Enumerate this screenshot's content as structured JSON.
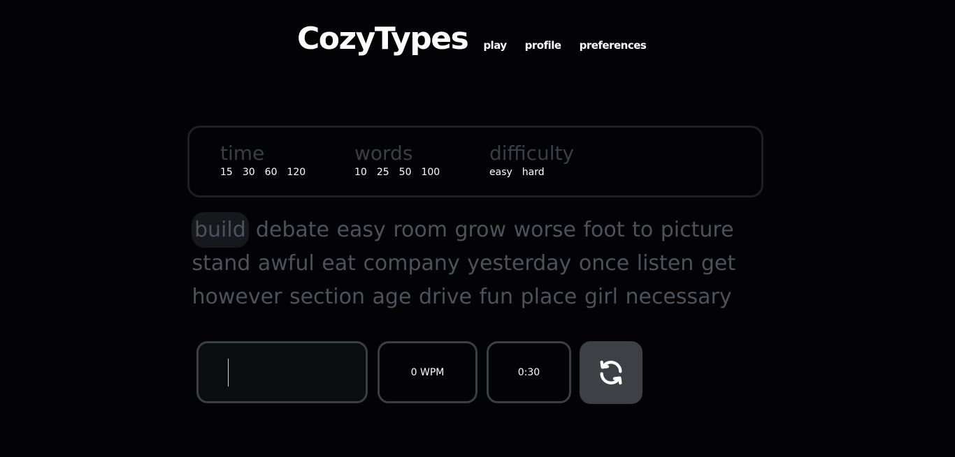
{
  "header": {
    "logo": "CozyTypes",
    "nav": [
      "play",
      "profile",
      "preferences"
    ]
  },
  "settings": {
    "time": {
      "title": "time",
      "options": [
        "15",
        "30",
        "60",
        "120"
      ]
    },
    "words": {
      "title": "words",
      "options": [
        "10",
        "25",
        "50",
        "100"
      ]
    },
    "difficulty": {
      "title": "difficulty",
      "options": [
        "easy",
        "hard"
      ]
    }
  },
  "words": [
    "build",
    "debate",
    "easy",
    "room",
    "grow",
    "worse",
    "foot",
    "to",
    "picture",
    "stand",
    "awful",
    "eat",
    "company",
    "yesterday",
    "once",
    "listen",
    "get",
    "however",
    "section",
    "age",
    "drive",
    "fun",
    "place",
    "girl",
    "necessary"
  ],
  "stats": {
    "wpm": "0 WPM",
    "timer": "0:30"
  },
  "input": {
    "value": ""
  },
  "icons": {
    "restart": "refresh-icon"
  },
  "colors": {
    "background": "#030305",
    "text_muted": "#4b525a",
    "border": "#3b3f44",
    "button": "#3d4145"
  }
}
